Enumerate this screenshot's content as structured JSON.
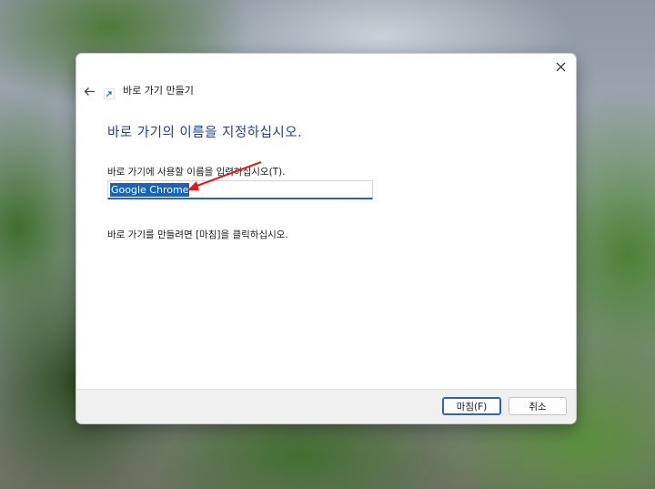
{
  "dialog": {
    "title": "바로 가기 만들기",
    "heading": "바로 가기의 이름을 지정하십시오.",
    "field_label": "바로 가기에 사용할 이름을 입력하십시오(T).",
    "name_value": "Google Chrome",
    "instruction": "바로 가기를 만들려면 [마침]을 클릭하십시오.",
    "finish_label": "마침(F)",
    "cancel_label": "취소"
  },
  "icons": {
    "close": "close-icon",
    "back": "back-arrow-icon",
    "shortcut": "shortcut-arrow-icon"
  },
  "colors": {
    "heading": "#1f3f9a",
    "accent": "#2a63b8",
    "selection": "#1565c0",
    "annotation_arrow": "#e01b1b"
  }
}
